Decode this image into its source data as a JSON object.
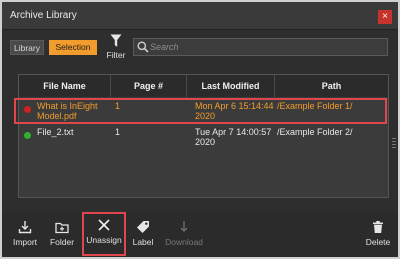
{
  "window": {
    "title": "Archive Library",
    "close_glyph": "×",
    "accent_color": "#f39c2e",
    "highlight_color": "#e0474c"
  },
  "toolbar": {
    "library_label": "Library",
    "selection_label": "Selection",
    "filter_label": "Filter",
    "search_placeholder": "Search",
    "search_value": ""
  },
  "table": {
    "columns": [
      "File Name",
      "Page #",
      "Last Modified",
      "Path"
    ],
    "rows": [
      {
        "status": "red",
        "file_name": "What is InEight Model.pdf",
        "page": "1",
        "modified": "Mon Apr 6 15:14:44 2020",
        "path": "/Example Folder 1/",
        "selected": true
      },
      {
        "status": "green",
        "file_name": "File_2.txt",
        "page": "1",
        "modified": "Tue Apr 7 14:00:57 2020",
        "path": "/Example Folder 2/",
        "selected": false
      }
    ]
  },
  "bottom_toolbar": [
    {
      "label": "Import",
      "icon": "import-icon",
      "enabled": true
    },
    {
      "label": "Folder",
      "icon": "folder-icon",
      "enabled": true
    },
    {
      "label": "Unassign",
      "icon": "unassign-x-icon",
      "enabled": true,
      "highlighted": true
    },
    {
      "label": "Label",
      "icon": "tag-icon",
      "enabled": true
    },
    {
      "label": "Download",
      "icon": "download-icon",
      "enabled": false
    },
    {
      "label": "Delete",
      "icon": "trash-icon",
      "enabled": true
    }
  ]
}
